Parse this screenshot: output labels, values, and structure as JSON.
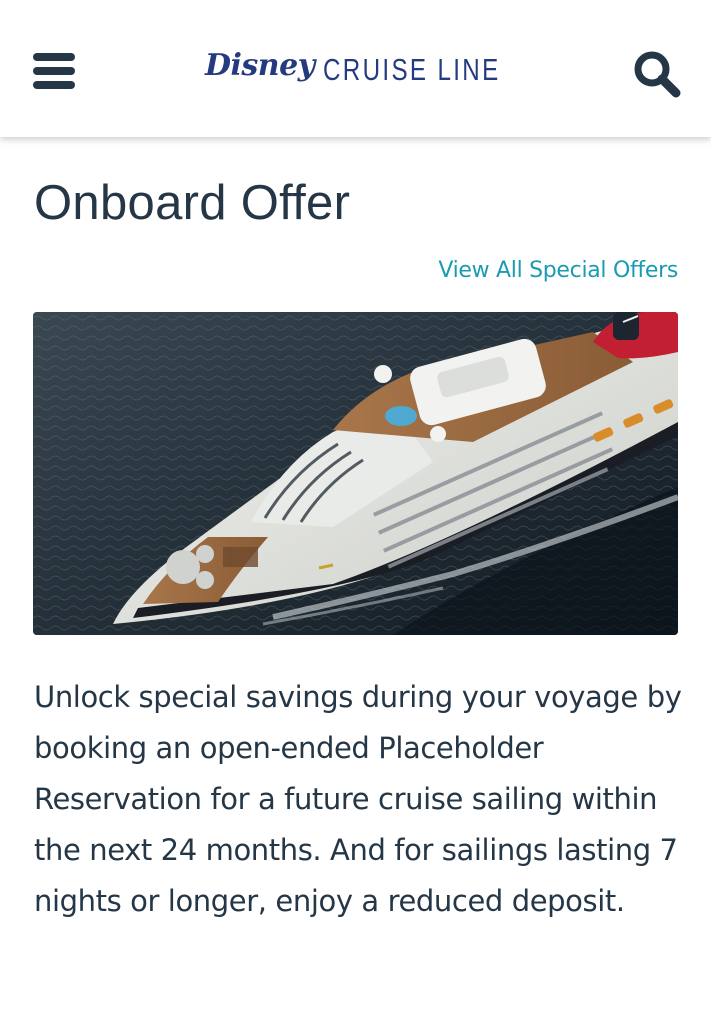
{
  "header": {
    "logo_script": "Disney",
    "logo_line": "CRUISE LINE",
    "menu_icon": "hamburger-menu-icon",
    "search_icon": "search-icon"
  },
  "main": {
    "title": "Onboard Offer",
    "link_label": "View All Special Offers",
    "body": "Unlock special savings during your voyage by booking an open-ended Placeholder Reservation for a future cruise sailing within the next 24 months. And for sailings lasting 7 nights or longer, enjoy a reduced deposit."
  },
  "colors": {
    "text": "#253746",
    "link": "#1a9bb1",
    "brand": "#253b80"
  }
}
